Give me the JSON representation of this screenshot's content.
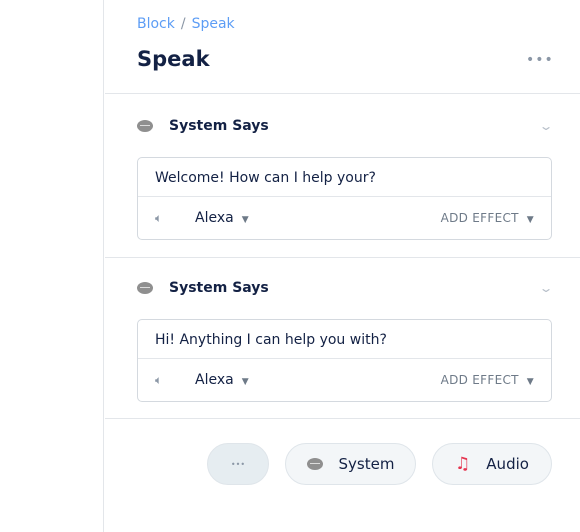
{
  "breadcrumb": {
    "parent": "Block",
    "separator": "/",
    "current": "Speak"
  },
  "title": "Speak",
  "more_icon": "ellipsis-icon",
  "sections": [
    {
      "title": "System Says",
      "text": "Welcome! How can I help your?",
      "voice": "Alexa",
      "effect_label": "ADD EFFECT"
    },
    {
      "title": "System Says",
      "text": "Hi! Anything I can help you with?",
      "voice": "Alexa",
      "effect_label": "ADD EFFECT"
    }
  ],
  "buttons": {
    "more": "•••",
    "system": "System",
    "audio": "Audio"
  },
  "colors": {
    "link": "#5d9df5",
    "audio_icon": "#e5344f"
  }
}
